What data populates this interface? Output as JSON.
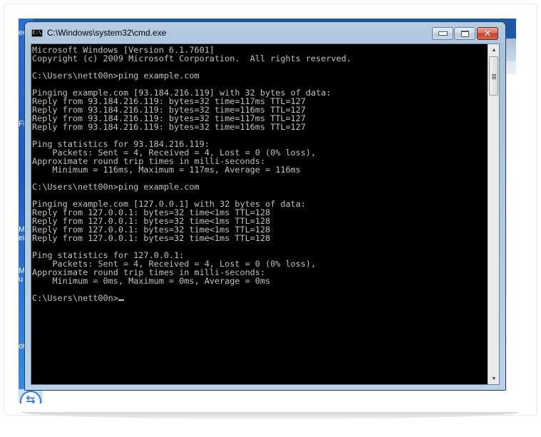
{
  "window": {
    "title": "C:\\Windows\\system32\\cmd.exe",
    "app_icon_label": "C:\\",
    "controls": {
      "minimize": "minimize",
      "maximize": "maximize",
      "close": "✕"
    }
  },
  "console": {
    "text_color": "#c0c0c0",
    "background": "#000000",
    "lines": [
      "Microsoft Windows [Version 6.1.7601]",
      "Copyright (c) 2009 Microsoft Corporation.  All rights reserved.",
      "",
      "C:\\Users\\nett00n>ping example.com",
      "",
      "Pinging example.com [93.184.216.119] with 32 bytes of data:",
      "Reply from 93.184.216.119: bytes=32 time=117ms TTL=127",
      "Reply from 93.184.216.119: bytes=32 time=116ms TTL=127",
      "Reply from 93.184.216.119: bytes=32 time=117ms TTL=127",
      "Reply from 93.184.216.119: bytes=32 time=116ms TTL=127",
      "",
      "Ping statistics for 93.184.216.119:",
      "    Packets: Sent = 4, Received = 4, Lost = 0 (0% loss),",
      "Approximate round trip times in milli-seconds:",
      "    Minimum = 116ms, Maximum = 117ms, Average = 116ms",
      "",
      "C:\\Users\\nett00n>ping example.com",
      "",
      "Pinging example.com [127.0.0.1] with 32 bytes of data:",
      "Reply from 127.0.0.1: bytes=32 time<1ms TTL=128",
      "Reply from 127.0.0.1: bytes=32 time<1ms TTL=128",
      "Reply from 127.0.0.1: bytes=32 time<1ms TTL=128",
      "Reply from 127.0.0.1: bytes=32 time<1ms TTL=128",
      "",
      "Ping statistics for 127.0.0.1:",
      "    Packets: Sent = 4, Received = 4, Lost = 0 (0% loss),",
      "Approximate round trip times in milli-seconds:",
      "    Minimum = 0ms, Maximum = 0ms, Average = 0ms",
      ""
    ],
    "prompt": "C:\\Users\\nett00n>"
  },
  "scrollbar": {
    "up_arrow": "▲",
    "down_arrow": "▼"
  },
  "desktop": {
    "icon_labels": [
      "ec",
      "Fi",
      "Mi",
      "ei",
      "M",
      "u",
      "ot"
    ]
  }
}
